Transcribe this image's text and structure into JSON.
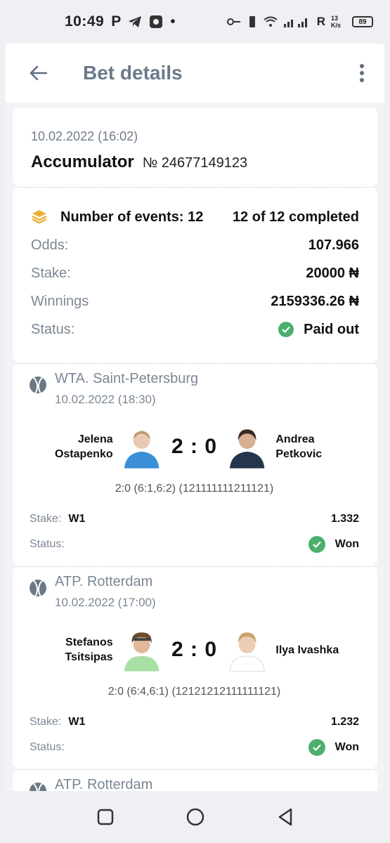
{
  "status_bar": {
    "time": "10:49",
    "right_text": "R",
    "speed": "13 K/s",
    "battery": "89"
  },
  "app_bar": {
    "title": "Bet details"
  },
  "bet": {
    "date": "10.02.2022 (16:02)",
    "type": "Accumulator",
    "number": "№ 24677149123"
  },
  "summary": {
    "events_label": "Number of events: 12",
    "completed": "12 of 12 completed",
    "odds_label": "Odds:",
    "odds_value": "107.966",
    "stake_label": "Stake:",
    "stake_value": "20000 ₦",
    "winnings_label": "Winnings",
    "winnings_value": "2159336.26 ₦",
    "status_label": "Status:",
    "status_value": "Paid out"
  },
  "events": [
    {
      "league": "WTA. Saint-Petersburg",
      "date": "10.02.2022 (18:30)",
      "home_first": "Jelena",
      "home_last": "Ostapenko",
      "away_first": "Andrea",
      "away_last": "Petkovic",
      "score": "2 : 0",
      "detail": "2:0 (6:1,6:2) (121111111211121)",
      "stake_label": "Stake:",
      "pick": "W1",
      "odds": "1.332",
      "status_label": "Status:",
      "status": "Won"
    },
    {
      "league": "ATP. Rotterdam",
      "date": "10.02.2022 (17:00)",
      "home_first": "Stefanos",
      "home_last": "Tsitsipas",
      "away_first": "",
      "away_last": "Ilya Ivashka",
      "score": "2 : 0",
      "detail": "2:0 (6:4,6:1) (12121212111111121)",
      "stake_label": "Stake:",
      "pick": "W1",
      "odds": "1.232",
      "status_label": "Status:",
      "status": "Won"
    },
    {
      "league": "ATP. Rotterdam"
    }
  ],
  "colors": {
    "accent_green": "#4caf6d",
    "muted": "#7b8794",
    "gold": "#e8b23a"
  },
  "icons": [
    "back-arrow-icon",
    "more-vert-icon",
    "coins-stack-icon",
    "tennis-ball-icon",
    "check-circle-icon",
    "square-nav-icon",
    "circle-nav-icon",
    "triangle-back-nav-icon"
  ]
}
